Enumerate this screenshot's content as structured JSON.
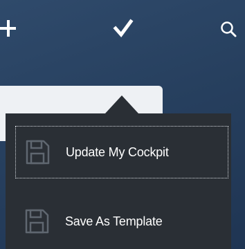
{
  "toolbar": {
    "add_icon": "plus-icon",
    "confirm_icon": "checkmark-icon",
    "search_icon": "search-icon"
  },
  "menu": {
    "items": [
      {
        "label": "Update My Cockpit",
        "icon": "floppy-disk-icon",
        "focused": true
      },
      {
        "label": "Save As Template",
        "icon": "floppy-disk-icon",
        "focused": false
      }
    ]
  },
  "colors": {
    "background": "#27405f",
    "popover": "#2a2f35",
    "card": "#eef1f4",
    "text": "#ffffff",
    "icon": "#5f6770"
  }
}
